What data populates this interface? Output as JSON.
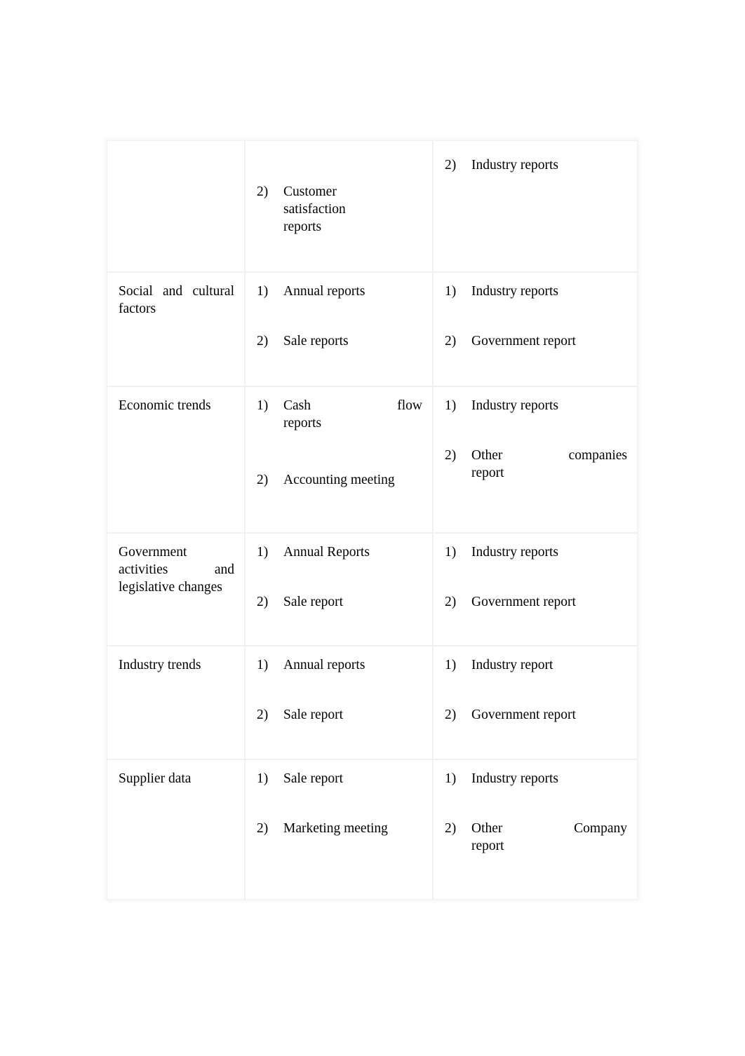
{
  "document": {
    "type": "table",
    "columns": 3,
    "rows": 6,
    "border_color": "#f0f0f0",
    "text_color": "#000000",
    "background": "#ffffff"
  },
  "table": {
    "rows": [
      {
        "factor": "",
        "internal": {
          "items": [
            {
              "marker": "2)",
              "lines": [
                "Customer",
                "satisfaction",
                "reports"
              ],
              "text": "Customer satisfaction reports"
            }
          ]
        },
        "external": {
          "items": [
            {
              "marker": "2)",
              "lines": [
                "Industry reports"
              ],
              "text": "Industry reports"
            }
          ]
        }
      },
      {
        "factor": "Social and cultural factors",
        "factor_lines": [
          "Social and cultural",
          "factors"
        ],
        "internal": {
          "items": [
            {
              "marker": "1)",
              "lines": [
                "Annual reports"
              ],
              "text": "Annual reports"
            },
            {
              "marker": "2)",
              "lines": [
                "Sale reports"
              ],
              "text": "Sale reports"
            }
          ]
        },
        "external": {
          "items": [
            {
              "marker": "1)",
              "lines": [
                "Industry reports"
              ],
              "text": "Industry reports"
            },
            {
              "marker": "2)",
              "lines": [
                "Government report"
              ],
              "text": "Government report"
            }
          ]
        }
      },
      {
        "factor": "Economic trends",
        "factor_lines": [
          "Economic trends"
        ],
        "internal": {
          "items": [
            {
              "marker": "1)",
              "lines": [
                "Cash flow",
                "reports"
              ],
              "text": "Cash flow reports"
            },
            {
              "marker": "2)",
              "lines": [
                "Accounting",
                "meeting"
              ],
              "text": "Accounting meeting"
            }
          ]
        },
        "external": {
          "items": [
            {
              "marker": "1)",
              "lines": [
                "Industry reports"
              ],
              "text": "Industry reports"
            },
            {
              "marker": "2)",
              "lines": [
                "Other companies",
                "report"
              ],
              "text": "Other companies report"
            }
          ]
        }
      },
      {
        "factor": "Government activities and legislative changes",
        "factor_lines": [
          "Government",
          "activities and",
          "legislative changes"
        ],
        "internal": {
          "items": [
            {
              "marker": "1)",
              "lines": [
                "Annual Reports"
              ],
              "text": "Annual Reports"
            },
            {
              "marker": "2)",
              "lines": [
                "Sale report"
              ],
              "text": "Sale report"
            }
          ]
        },
        "external": {
          "items": [
            {
              "marker": "1)",
              "lines": [
                "Industry reports"
              ],
              "text": "Industry reports"
            },
            {
              "marker": "2)",
              "lines": [
                "Government report"
              ],
              "text": "Government report"
            }
          ]
        }
      },
      {
        "factor": "Industry trends",
        "factor_lines": [
          "Industry trends"
        ],
        "internal": {
          "items": [
            {
              "marker": "1)",
              "lines": [
                "Annual reports"
              ],
              "text": "Annual reports"
            },
            {
              "marker": "2)",
              "lines": [
                "Sale report"
              ],
              "text": "Sale report"
            }
          ]
        },
        "external": {
          "items": [
            {
              "marker": "1)",
              "lines": [
                "Industry report"
              ],
              "text": "Industry report"
            },
            {
              "marker": "2)",
              "lines": [
                "Government report"
              ],
              "text": "Government report"
            }
          ]
        }
      },
      {
        "factor": "Supplier data",
        "factor_lines": [
          "Supplier data"
        ],
        "internal": {
          "items": [
            {
              "marker": "1)",
              "lines": [
                "Sale report"
              ],
              "text": "Sale report"
            },
            {
              "marker": "2)",
              "lines": [
                "Marketing",
                "meeting"
              ],
              "text": "Marketing meeting"
            }
          ]
        },
        "external": {
          "items": [
            {
              "marker": "1)",
              "lines": [
                "Industry reports"
              ],
              "text": "Industry reports"
            },
            {
              "marker": "2)",
              "lines": [
                "Other Company",
                "report"
              ],
              "text": "Other Company report"
            }
          ]
        }
      }
    ]
  }
}
